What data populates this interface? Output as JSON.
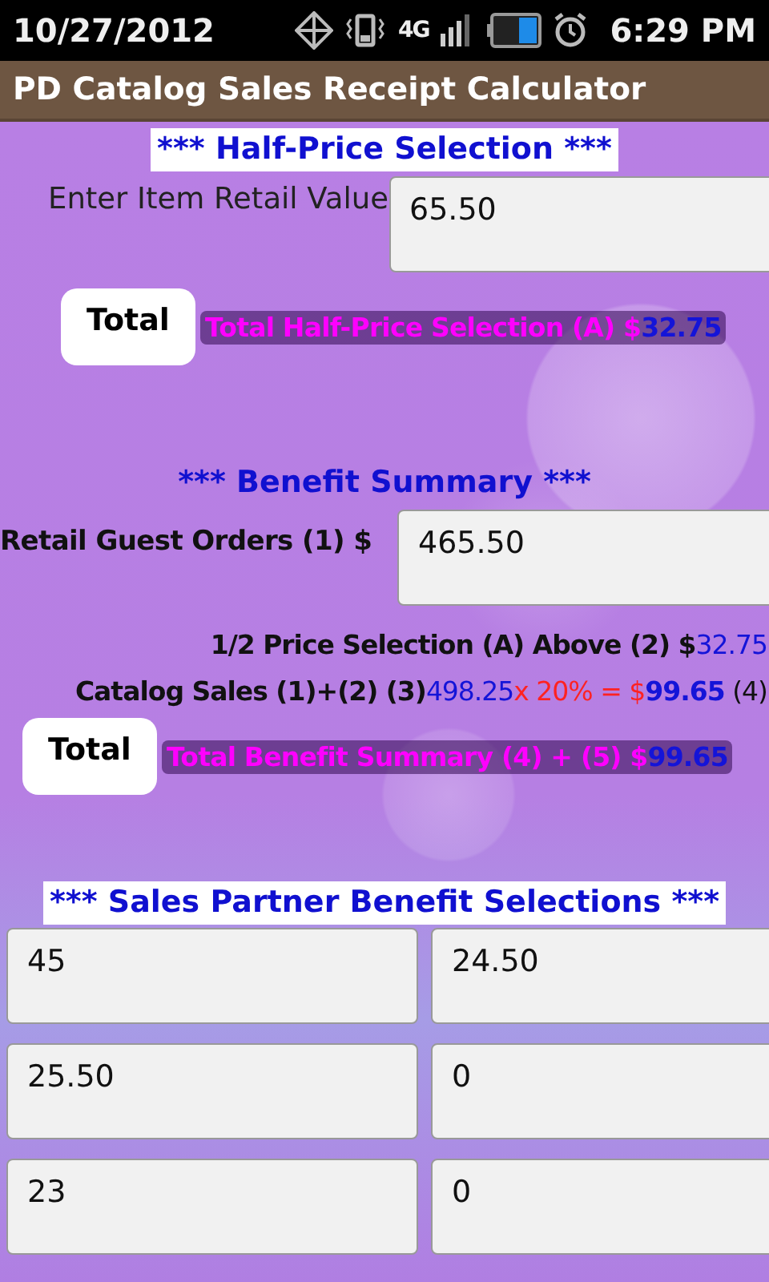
{
  "status_bar": {
    "date": "10/27/2012",
    "network": "4G",
    "time": "6:29 PM"
  },
  "title_bar": {
    "title": "PD Catalog Sales Receipt Calculator"
  },
  "half_price": {
    "heading": "*** Half-Price Selection ***",
    "field_label": "Enter Item Retail Value",
    "field_value": "65.50",
    "button": "Total",
    "result": [
      {
        "text": "Total Half-Price Selection (A) $",
        "color": "#ff00ff",
        "bold": true
      },
      {
        "text": "32.75",
        "color": "#1414d8",
        "bold": true
      }
    ]
  },
  "benefit_summary": {
    "heading": "*** Benefit Summary ***",
    "field_label": "Retail Guest Orders (1) $",
    "field_value": "465.50",
    "lines": [
      [
        {
          "text": "1/2 Price Selection (A) Above (2) $",
          "color": "#111111",
          "bold": true
        },
        {
          "text": "32.75",
          "color": "#1414d8",
          "bold": false
        }
      ],
      [
        {
          "text": "Catalog Sales (1)+(2)  (3)",
          "color": "#111111",
          "bold": true
        },
        {
          "text": "498.25",
          "color": "#1414d8",
          "bold": false
        },
        {
          "text": "x 20% = $",
          "color": "#ff2222",
          "bold": false
        },
        {
          "text": "99.65",
          "color": "#1414d8",
          "bold": true
        },
        {
          "text": " (4)",
          "color": "#111111",
          "bold": false
        }
      ]
    ],
    "button": "Total",
    "result": [
      {
        "text": "Total Benefit Summary (4) + (5) $",
        "color": "#ff00ff",
        "bold": true
      },
      {
        "text": "99.65",
        "color": "#1414d8",
        "bold": true
      }
    ]
  },
  "partner_selections": {
    "heading": "*** Sales Partner Benefit Selections ***",
    "fields": [
      "45",
      "24.50",
      "25.50",
      "0",
      "23",
      "0"
    ]
  }
}
